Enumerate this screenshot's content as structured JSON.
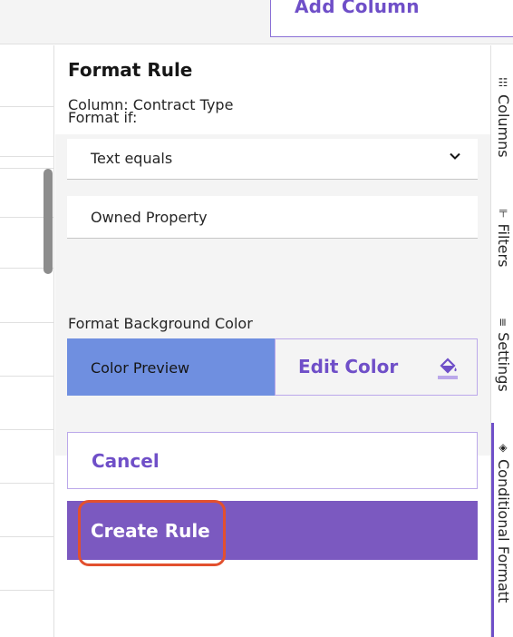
{
  "header": {
    "add_column_label": "Add Column"
  },
  "panel": {
    "title": "Format Rule",
    "subtitle": "Column: Contract Type",
    "format_if_label": "Format if:",
    "condition_select": {
      "value": "Text equals"
    },
    "value_input": {
      "value": "Owned Property"
    },
    "background_label": "Format Background Color",
    "color_preview_label": "Color Preview",
    "edit_color_label": "Edit Color",
    "cancel_label": "Cancel",
    "create_label": "Create Rule"
  },
  "rail": {
    "columns": "Columns",
    "filters": "Filters",
    "settings": "Settings",
    "conditional": "Conditional Formatt"
  },
  "colors": {
    "accent": "#6f4fc8",
    "primary_button": "#7b59c0",
    "preview_color": "#6f8fe0",
    "highlight": "#e2502e"
  },
  "icons": [
    "grid-icon",
    "filter-icon",
    "settings-icon",
    "paint-bucket-icon",
    "chevron-down-icon"
  ]
}
